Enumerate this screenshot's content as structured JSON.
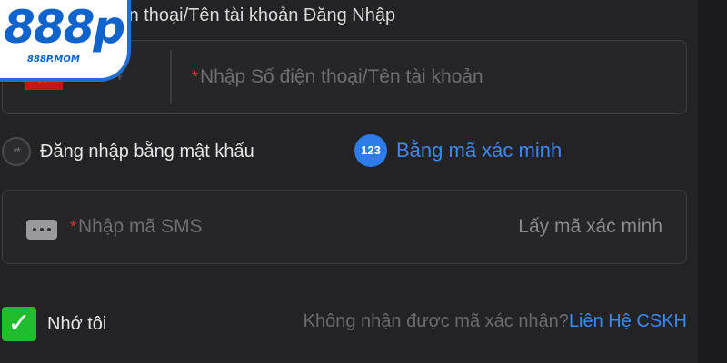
{
  "logo": {
    "text": "888p",
    "subtext": "888P.MOM"
  },
  "form": {
    "title": "iện thoại/Tên tài khoản Đăng Nhập"
  },
  "phone_field": {
    "dial_code": "+84",
    "required_mark": "*",
    "placeholder": "Nhập Số điện thoại/Tên tài khoản",
    "flag_icon": "vietnam-flag-icon"
  },
  "login_options": {
    "password_label": "Đăng nhập bằng mật khẩu",
    "password_icon_glyph": "**",
    "code_label": "Bằng mã xác minh",
    "code_badge": "123"
  },
  "sms_field": {
    "required_mark": "*",
    "placeholder": "Nhập mã SMS",
    "get_code_label": "Lấy mã xác minh"
  },
  "remember": {
    "label": "Nhớ tôi",
    "checked": true
  },
  "help": {
    "text": "Không nhận được mã xác nhận?",
    "link_label": "Liên Hệ CSKH"
  },
  "colors": {
    "background": "#232325",
    "accent": "#3b88f0",
    "required": "#d8383a",
    "check": "#1fbd2e"
  }
}
